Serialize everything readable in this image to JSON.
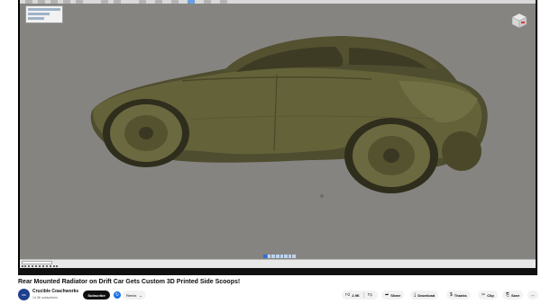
{
  "video": {
    "title": "Rear Mounted Radiator on Drift Car Gets Custom 3D Printed Side Scoops!"
  },
  "channel": {
    "name": "Crucible Coachworks",
    "subscribers": "14.3K subscribers",
    "avatar_text": "CC"
  },
  "buttons": {
    "subscribe": "Subscribe",
    "remix": "Remix",
    "like_count": "2.9K",
    "share": "Share",
    "download": "Download",
    "thanks": "Thanks",
    "clip": "Clip",
    "save": "Save",
    "more": "···"
  },
  "icons": {
    "like": "thumbs-up-icon",
    "dislike": "thumbs-down-icon",
    "share": "share-arrow-icon",
    "download": "download-arrow-icon",
    "thanks": "dollar-heart-icon",
    "clip": "scissors-icon",
    "save": "bookmark-icon",
    "dropdown": "chevron-down-icon"
  },
  "colors": {
    "viewport_bg": "#858481",
    "model_body": "#5e5c38",
    "subscribe_bg": "#0f0f0f",
    "remix_accent": "#1a73e8"
  }
}
